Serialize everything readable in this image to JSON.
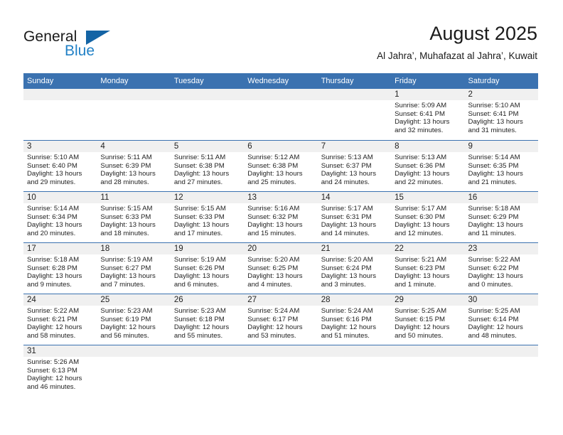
{
  "brand": {
    "line1": "General",
    "line2": "Blue",
    "flag_color": "#1464a5",
    "blue_text_color": "#2281c6"
  },
  "header": {
    "title": "August 2025",
    "subtitle": "Al Jahra’, Muhafazat al Jahra’, Kuwait",
    "accent_color": "#3b72b0",
    "date_band_color": "#f0f0f0"
  },
  "calendar": {
    "weekdays": [
      "Sunday",
      "Monday",
      "Tuesday",
      "Wednesday",
      "Thursday",
      "Friday",
      "Saturday"
    ],
    "weeks": [
      [
        {
          "day": "",
          "empty": true
        },
        {
          "day": "",
          "empty": true
        },
        {
          "day": "",
          "empty": true
        },
        {
          "day": "",
          "empty": true
        },
        {
          "day": "",
          "empty": true
        },
        {
          "day": "1",
          "sunrise": "Sunrise: 5:09 AM",
          "sunset": "Sunset: 6:41 PM",
          "daylight1": "Daylight: 13 hours",
          "daylight2": "and 32 minutes."
        },
        {
          "day": "2",
          "sunrise": "Sunrise: 5:10 AM",
          "sunset": "Sunset: 6:41 PM",
          "daylight1": "Daylight: 13 hours",
          "daylight2": "and 31 minutes."
        }
      ],
      [
        {
          "day": "3",
          "sunrise": "Sunrise: 5:10 AM",
          "sunset": "Sunset: 6:40 PM",
          "daylight1": "Daylight: 13 hours",
          "daylight2": "and 29 minutes."
        },
        {
          "day": "4",
          "sunrise": "Sunrise: 5:11 AM",
          "sunset": "Sunset: 6:39 PM",
          "daylight1": "Daylight: 13 hours",
          "daylight2": "and 28 minutes."
        },
        {
          "day": "5",
          "sunrise": "Sunrise: 5:11 AM",
          "sunset": "Sunset: 6:38 PM",
          "daylight1": "Daylight: 13 hours",
          "daylight2": "and 27 minutes."
        },
        {
          "day": "6",
          "sunrise": "Sunrise: 5:12 AM",
          "sunset": "Sunset: 6:38 PM",
          "daylight1": "Daylight: 13 hours",
          "daylight2": "and 25 minutes."
        },
        {
          "day": "7",
          "sunrise": "Sunrise: 5:13 AM",
          "sunset": "Sunset: 6:37 PM",
          "daylight1": "Daylight: 13 hours",
          "daylight2": "and 24 minutes."
        },
        {
          "day": "8",
          "sunrise": "Sunrise: 5:13 AM",
          "sunset": "Sunset: 6:36 PM",
          "daylight1": "Daylight: 13 hours",
          "daylight2": "and 22 minutes."
        },
        {
          "day": "9",
          "sunrise": "Sunrise: 5:14 AM",
          "sunset": "Sunset: 6:35 PM",
          "daylight1": "Daylight: 13 hours",
          "daylight2": "and 21 minutes."
        }
      ],
      [
        {
          "day": "10",
          "sunrise": "Sunrise: 5:14 AM",
          "sunset": "Sunset: 6:34 PM",
          "daylight1": "Daylight: 13 hours",
          "daylight2": "and 20 minutes."
        },
        {
          "day": "11",
          "sunrise": "Sunrise: 5:15 AM",
          "sunset": "Sunset: 6:33 PM",
          "daylight1": "Daylight: 13 hours",
          "daylight2": "and 18 minutes."
        },
        {
          "day": "12",
          "sunrise": "Sunrise: 5:15 AM",
          "sunset": "Sunset: 6:33 PM",
          "daylight1": "Daylight: 13 hours",
          "daylight2": "and 17 minutes."
        },
        {
          "day": "13",
          "sunrise": "Sunrise: 5:16 AM",
          "sunset": "Sunset: 6:32 PM",
          "daylight1": "Daylight: 13 hours",
          "daylight2": "and 15 minutes."
        },
        {
          "day": "14",
          "sunrise": "Sunrise: 5:17 AM",
          "sunset": "Sunset: 6:31 PM",
          "daylight1": "Daylight: 13 hours",
          "daylight2": "and 14 minutes."
        },
        {
          "day": "15",
          "sunrise": "Sunrise: 5:17 AM",
          "sunset": "Sunset: 6:30 PM",
          "daylight1": "Daylight: 13 hours",
          "daylight2": "and 12 minutes."
        },
        {
          "day": "16",
          "sunrise": "Sunrise: 5:18 AM",
          "sunset": "Sunset: 6:29 PM",
          "daylight1": "Daylight: 13 hours",
          "daylight2": "and 11 minutes."
        }
      ],
      [
        {
          "day": "17",
          "sunrise": "Sunrise: 5:18 AM",
          "sunset": "Sunset: 6:28 PM",
          "daylight1": "Daylight: 13 hours",
          "daylight2": "and 9 minutes."
        },
        {
          "day": "18",
          "sunrise": "Sunrise: 5:19 AM",
          "sunset": "Sunset: 6:27 PM",
          "daylight1": "Daylight: 13 hours",
          "daylight2": "and 7 minutes."
        },
        {
          "day": "19",
          "sunrise": "Sunrise: 5:19 AM",
          "sunset": "Sunset: 6:26 PM",
          "daylight1": "Daylight: 13 hours",
          "daylight2": "and 6 minutes."
        },
        {
          "day": "20",
          "sunrise": "Sunrise: 5:20 AM",
          "sunset": "Sunset: 6:25 PM",
          "daylight1": "Daylight: 13 hours",
          "daylight2": "and 4 minutes."
        },
        {
          "day": "21",
          "sunrise": "Sunrise: 5:20 AM",
          "sunset": "Sunset: 6:24 PM",
          "daylight1": "Daylight: 13 hours",
          "daylight2": "and 3 minutes."
        },
        {
          "day": "22",
          "sunrise": "Sunrise: 5:21 AM",
          "sunset": "Sunset: 6:23 PM",
          "daylight1": "Daylight: 13 hours",
          "daylight2": "and 1 minute."
        },
        {
          "day": "23",
          "sunrise": "Sunrise: 5:22 AM",
          "sunset": "Sunset: 6:22 PM",
          "daylight1": "Daylight: 13 hours",
          "daylight2": "and 0 minutes."
        }
      ],
      [
        {
          "day": "24",
          "sunrise": "Sunrise: 5:22 AM",
          "sunset": "Sunset: 6:21 PM",
          "daylight1": "Daylight: 12 hours",
          "daylight2": "and 58 minutes."
        },
        {
          "day": "25",
          "sunrise": "Sunrise: 5:23 AM",
          "sunset": "Sunset: 6:19 PM",
          "daylight1": "Daylight: 12 hours",
          "daylight2": "and 56 minutes."
        },
        {
          "day": "26",
          "sunrise": "Sunrise: 5:23 AM",
          "sunset": "Sunset: 6:18 PM",
          "daylight1": "Daylight: 12 hours",
          "daylight2": "and 55 minutes."
        },
        {
          "day": "27",
          "sunrise": "Sunrise: 5:24 AM",
          "sunset": "Sunset: 6:17 PM",
          "daylight1": "Daylight: 12 hours",
          "daylight2": "and 53 minutes."
        },
        {
          "day": "28",
          "sunrise": "Sunrise: 5:24 AM",
          "sunset": "Sunset: 6:16 PM",
          "daylight1": "Daylight: 12 hours",
          "daylight2": "and 51 minutes."
        },
        {
          "day": "29",
          "sunrise": "Sunrise: 5:25 AM",
          "sunset": "Sunset: 6:15 PM",
          "daylight1": "Daylight: 12 hours",
          "daylight2": "and 50 minutes."
        },
        {
          "day": "30",
          "sunrise": "Sunrise: 5:25 AM",
          "sunset": "Sunset: 6:14 PM",
          "daylight1": "Daylight: 12 hours",
          "daylight2": "and 48 minutes."
        }
      ],
      [
        {
          "day": "31",
          "sunrise": "Sunrise: 5:26 AM",
          "sunset": "Sunset: 6:13 PM",
          "daylight1": "Daylight: 12 hours",
          "daylight2": "and 46 minutes."
        },
        {
          "day": "",
          "empty": true
        },
        {
          "day": "",
          "empty": true
        },
        {
          "day": "",
          "empty": true
        },
        {
          "day": "",
          "empty": true
        },
        {
          "day": "",
          "empty": true
        },
        {
          "day": "",
          "empty": true
        }
      ]
    ]
  }
}
